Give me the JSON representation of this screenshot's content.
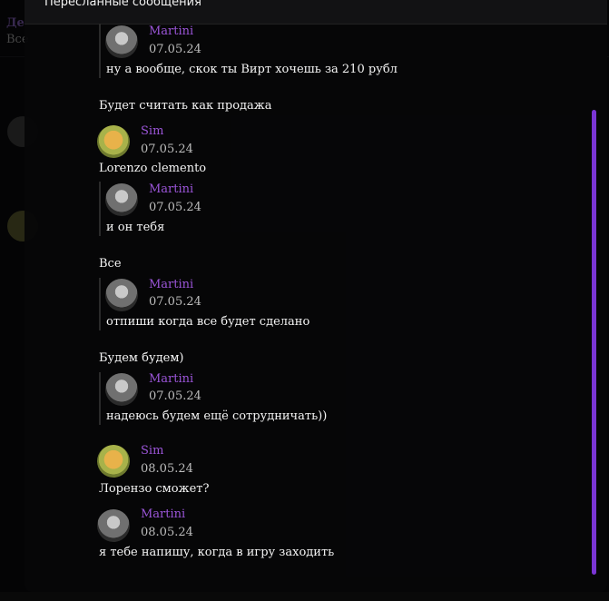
{
  "colors": {
    "accent_author": "#9b55d8",
    "scrollbar": "#7a35d4",
    "background": "#0b0b0d"
  },
  "modal": {
    "title": "Пересланные сообщения"
  },
  "messages": [
    {
      "kind": "quote",
      "author": "Martini",
      "avatar": "martini-avatar",
      "date": "07.05.24",
      "text": "ну а вообще, скок ты Вирт хочешь за 210 рубл"
    },
    {
      "kind": "plain",
      "text": "Будет считать как продажа"
    },
    {
      "kind": "main",
      "author": "Sim",
      "avatar": "sim-avatar",
      "date": "07.05.24",
      "text": "Lorenzo clemento"
    },
    {
      "kind": "quote",
      "author": "Martini",
      "avatar": "martini-avatar",
      "date": "07.05.24",
      "text": "и он тебя"
    },
    {
      "kind": "plain",
      "text": "Все"
    },
    {
      "kind": "quote",
      "author": "Martini",
      "avatar": "martini-avatar",
      "date": "07.05.24",
      "text": "отпиши когда все будет сделано"
    },
    {
      "kind": "plain",
      "text": "Будем будем)"
    },
    {
      "kind": "quote",
      "author": "Martini",
      "avatar": "martini-avatar",
      "date": "07.05.24",
      "text": "надеюсь будем ещё сотрудничать))"
    },
    {
      "kind": "main",
      "author": "Sim",
      "avatar": "sim-avatar",
      "date": "08.05.24",
      "text": "Лорензо сможет?"
    },
    {
      "kind": "main",
      "author": "Martini",
      "avatar": "martini-avatar",
      "date": "08.05.24",
      "text": "я тебе напишу, когда в игру заходить"
    }
  ]
}
